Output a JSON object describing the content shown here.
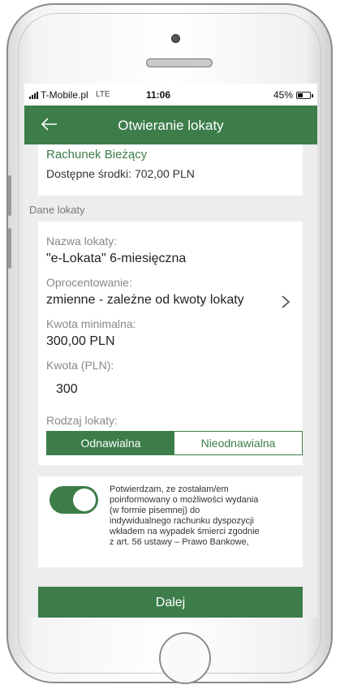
{
  "status_bar": {
    "carrier": "T-Mobile.pl",
    "network": "LTE",
    "time": "11:06",
    "battery_text": "45%",
    "battery_level": 0.45
  },
  "header": {
    "title": "Otwieranie lokaty",
    "back_icon": "back-arrow-icon"
  },
  "account": {
    "name": "Rachunek Bieżący",
    "available_funds": "Dostępne środki: 702,00 PLN"
  },
  "deposit_section": {
    "label": "Dane lokaty",
    "name_label": "Nazwa lokaty:",
    "name_value": "\"e-Lokata\" 6-miesięczna",
    "rate_label": "Oprocentowanie:",
    "rate_value": "zmienne - zależne od kwoty lokaty",
    "min_label": "Kwota minimalna:",
    "min_value": "300,00 PLN",
    "amount_label": "Kwota (PLN):",
    "amount_value": "300",
    "type_label": "Rodzaj lokaty:",
    "type_options": [
      "Odnawialna",
      "Nieodnawialna"
    ],
    "type_selected": "Odnawialna"
  },
  "consent": {
    "toggle_on": true,
    "text": "Potwierdzam, ze zostałam/em\npoinformowany o możliwości wydania\n(w formie pisemnej) do\nindywidualnego rachunku dyspozycji\nwkładem na wypadek śmierci zgodnie\nz  art. 56  ustawy – Prawo Bankowe,"
  },
  "footer": {
    "next_label": "Dalej"
  }
}
